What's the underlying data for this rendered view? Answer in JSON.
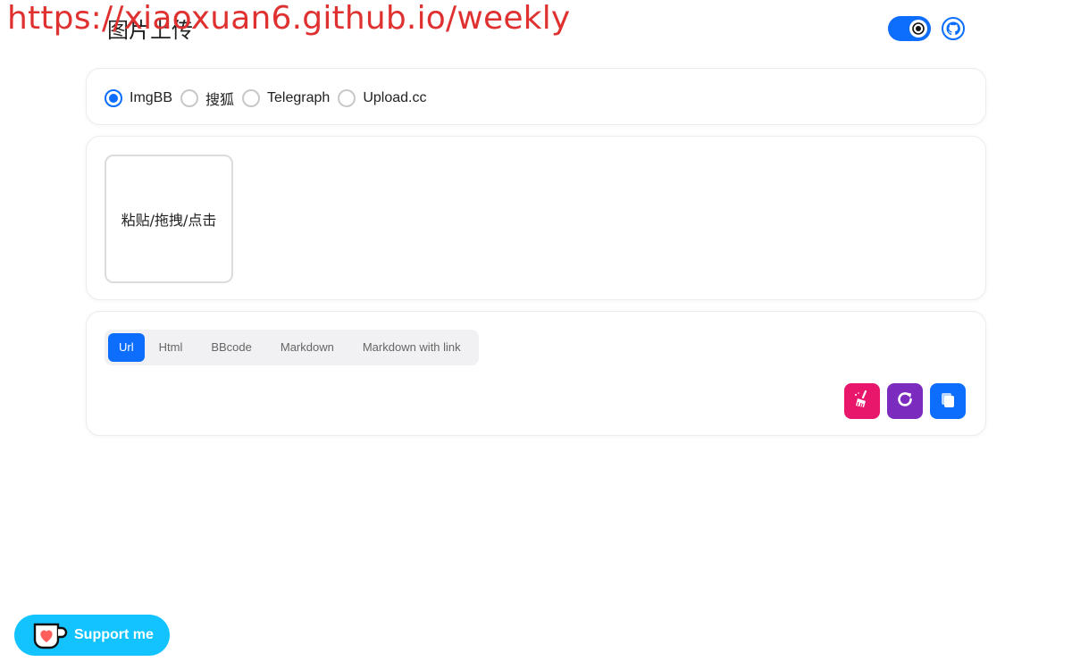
{
  "watermark": "https://xiaoxuan6.github.io/weekly",
  "header": {
    "title": "图片上传"
  },
  "hosts": {
    "options": [
      {
        "label": "ImgBB",
        "checked": true
      },
      {
        "label": "搜狐",
        "checked": false
      },
      {
        "label": "Telegraph",
        "checked": false
      },
      {
        "label": "Upload.cc",
        "checked": false
      }
    ]
  },
  "upload": {
    "dropzone_text": "粘贴/拖拽/点击"
  },
  "output": {
    "tabs": [
      "Url",
      "Html",
      "BBcode",
      "Markdown",
      "Markdown with link"
    ],
    "active_tab": "Url"
  },
  "actions": {
    "clear_icon": "broom-icon",
    "refresh_icon": "refresh-icon",
    "copy_icon": "copy-icon"
  },
  "support": {
    "label": "Support me"
  },
  "colors": {
    "primary": "#0d6efd",
    "clear": "#e8176b",
    "refresh": "#7b2cbf",
    "support": "#13c3ff",
    "watermark": "#e03131"
  }
}
